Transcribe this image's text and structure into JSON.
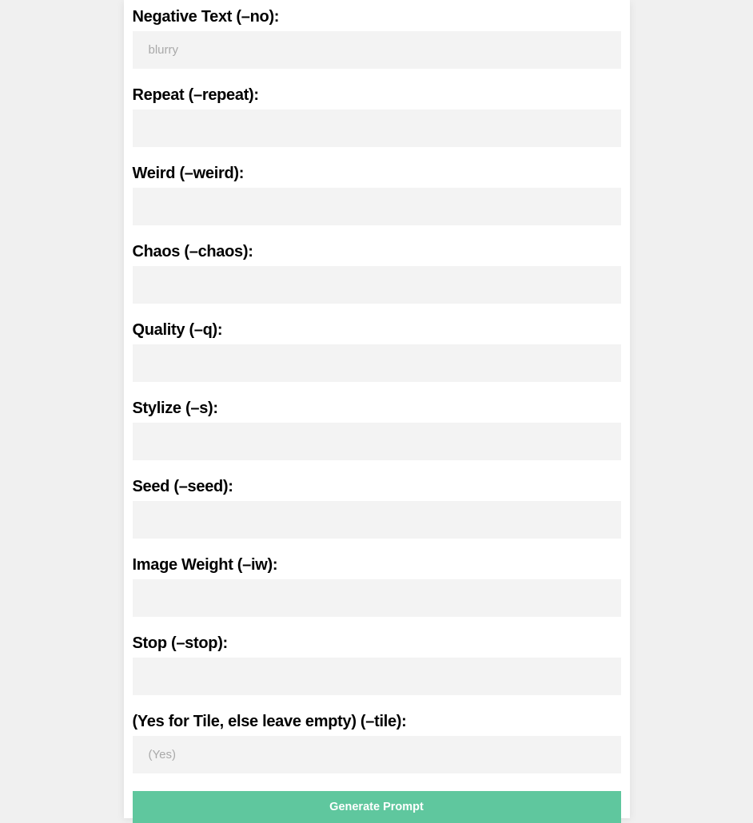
{
  "fields": {
    "negative_text": {
      "label": "Negative Text (–no):",
      "placeholder": "blurry",
      "value": ""
    },
    "repeat": {
      "label": "Repeat (–repeat):",
      "placeholder": "",
      "value": ""
    },
    "weird": {
      "label": "Weird (–weird):",
      "placeholder": "",
      "value": ""
    },
    "chaos": {
      "label": "Chaos (–chaos):",
      "placeholder": "",
      "value": ""
    },
    "quality": {
      "label": "Quality (–q):",
      "placeholder": "",
      "value": ""
    },
    "stylize": {
      "label": "Stylize (–s):",
      "placeholder": "",
      "value": ""
    },
    "seed": {
      "label": "Seed (–seed):",
      "placeholder": "",
      "value": ""
    },
    "image_weight": {
      "label": "Image Weight (–iw):",
      "placeholder": "",
      "value": ""
    },
    "stop": {
      "label": "Stop (–stop):",
      "placeholder": "",
      "value": ""
    },
    "tile": {
      "label": "(Yes for Tile, else leave empty) (–tile):",
      "placeholder": "(Yes)",
      "value": ""
    }
  },
  "button": {
    "generate_label": "Generate Prompt"
  }
}
